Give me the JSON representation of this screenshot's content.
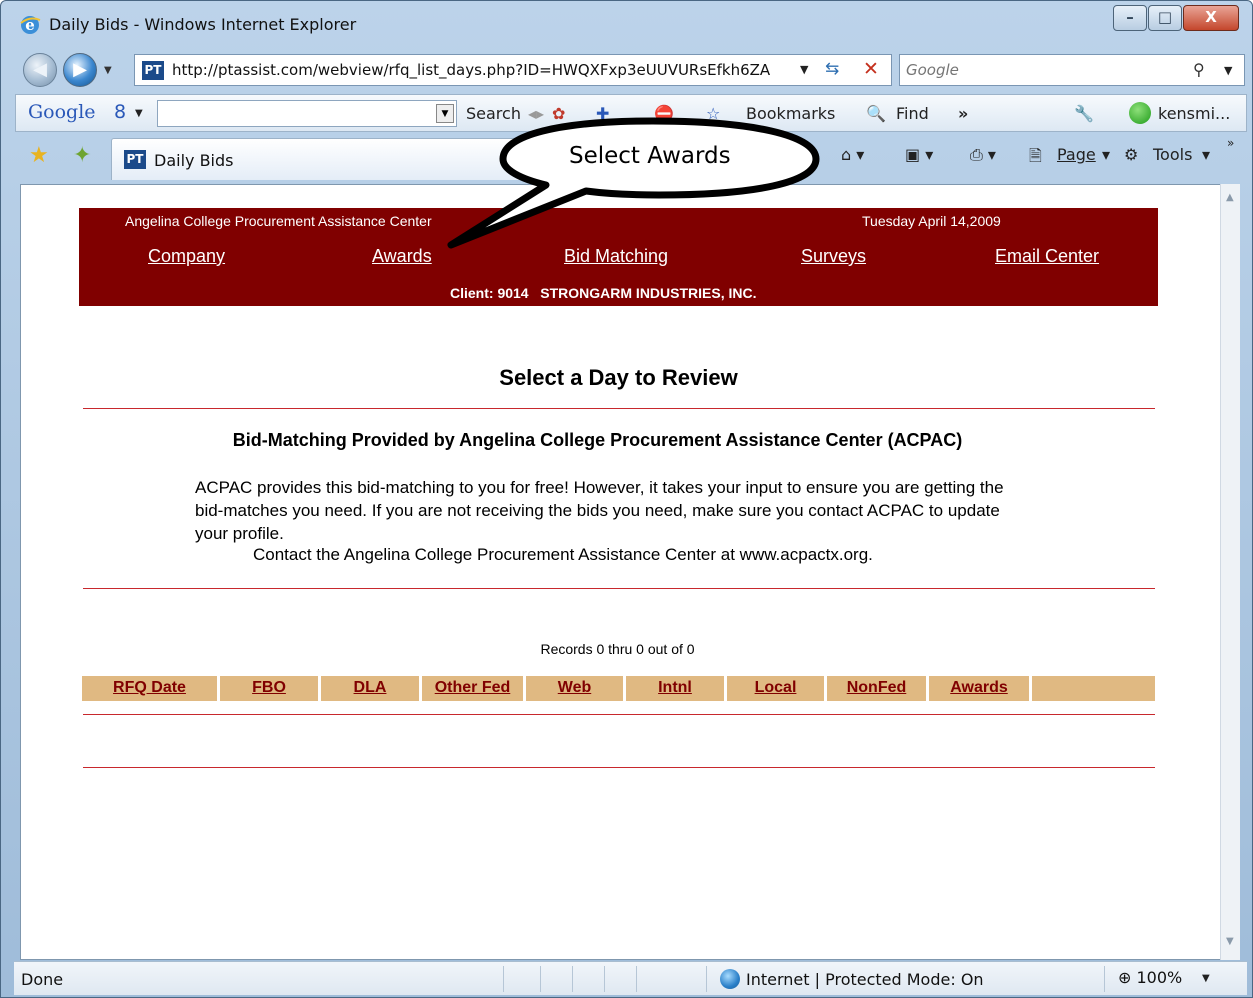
{
  "window": {
    "title": "Daily Bids - Windows Internet Explorer",
    "controls": {
      "minimize": "–",
      "maximize": "□",
      "close": "X"
    }
  },
  "address_bar": {
    "url": "http://ptassist.com/webview/rfq_list_days.php?ID=HWQXFxp3eUUVURsEfkh6ZA",
    "search_placeholder": "Google"
  },
  "google_toolbar": {
    "logo": "Google",
    "search_label": "Search",
    "bookmarks_label": "Bookmarks",
    "find_label": "Find",
    "more": "»",
    "account": "kensmi..."
  },
  "tab_bar": {
    "tab_label": "Daily Bids",
    "page_menu": "Page",
    "tools_menu": "Tools"
  },
  "callout": {
    "text": "Select Awards"
  },
  "header": {
    "org": "Angelina College Procurement Assistance Center",
    "date": "Tuesday April 14,2009",
    "nav": [
      "Company",
      "Awards",
      "Bid Matching",
      "Surveys",
      "Email Center"
    ],
    "client_label": "Client: 9014",
    "client_name": "STRONGARM INDUSTRIES, INC."
  },
  "main": {
    "heading": "Select a Day to Review",
    "subheading": "Bid-Matching Provided by Angelina College Procurement Assistance Center (ACPAC)",
    "paragraph": "ACPAC provides this bid-matching to you for free! However, it takes your input to ensure you are getting the bid-matches you need. If you are not receiving the bids you need, make sure you contact ACPAC to update your profile.",
    "contact": "Contact the Angelina College Procurement Assistance Center at www.acpactx.org.",
    "records": "Records 0 thru 0 out of 0"
  },
  "table": {
    "columns": [
      "RFQ Date",
      "FBO",
      "DLA",
      "Other Fed",
      "Web",
      "Intnl",
      "Local",
      "NonFed",
      "Awards",
      ""
    ]
  },
  "status_bar": {
    "status": "Done",
    "zone": "Internet | Protected Mode: On",
    "zoom": "100%"
  },
  "colors": {
    "header_bg": "#800000",
    "table_header_bg": "#e0b982",
    "rule": "#c8282d"
  }
}
